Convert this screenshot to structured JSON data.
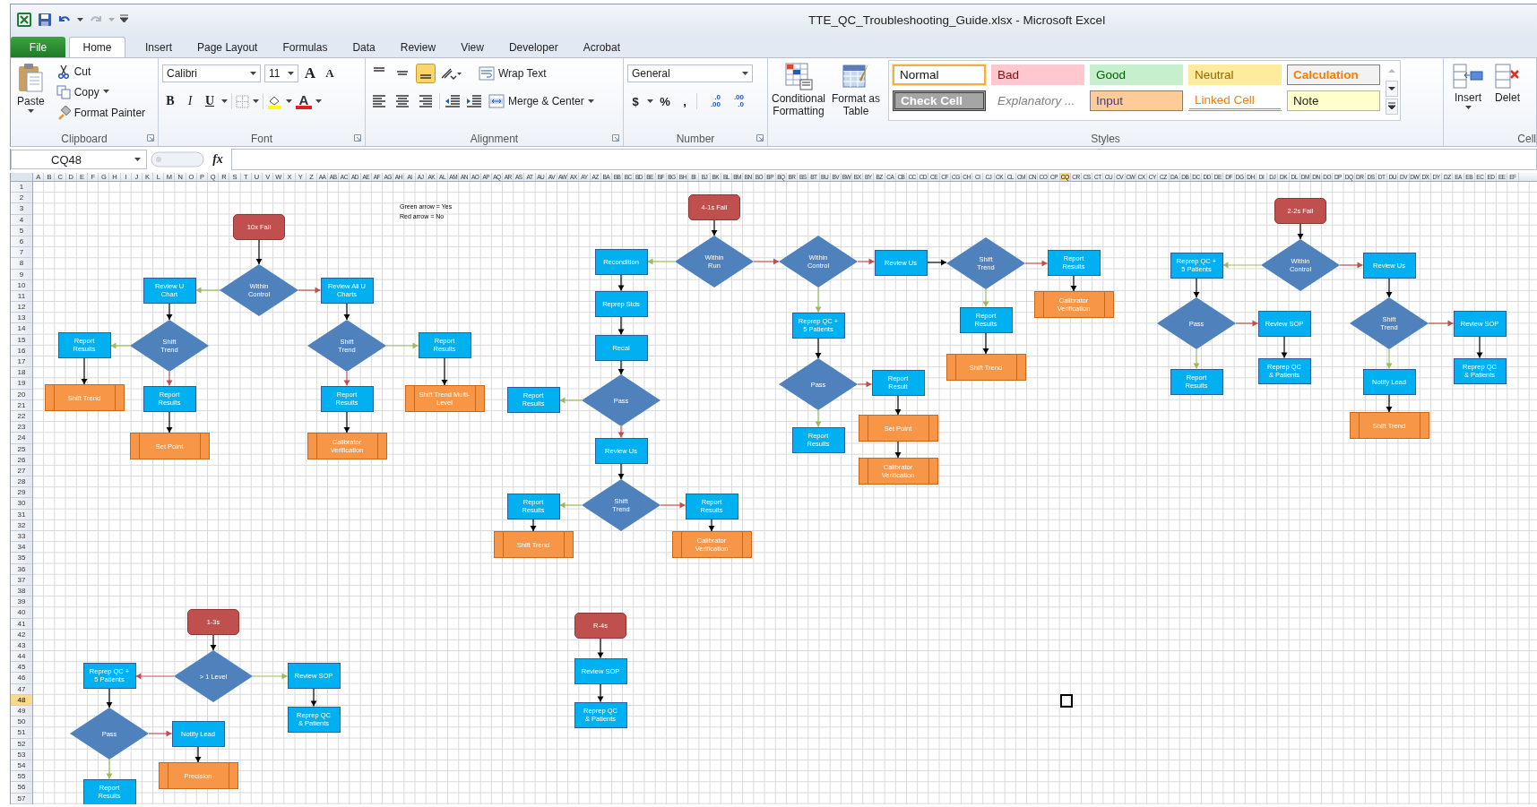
{
  "window": {
    "title": "TTE_QC_Troubleshooting_Guide.xlsx  -  Microsoft Excel"
  },
  "tabs": [
    {
      "label": "File",
      "kind": "file",
      "selected": false
    },
    {
      "label": "Home",
      "kind": "tab",
      "selected": true
    },
    {
      "label": "Insert",
      "kind": "tab",
      "selected": false
    },
    {
      "label": "Page Layout",
      "kind": "tab",
      "selected": false
    },
    {
      "label": "Formulas",
      "kind": "tab",
      "selected": false
    },
    {
      "label": "Data",
      "kind": "tab",
      "selected": false
    },
    {
      "label": "Review",
      "kind": "tab",
      "selected": false
    },
    {
      "label": "View",
      "kind": "tab",
      "selected": false
    },
    {
      "label": "Developer",
      "kind": "tab",
      "selected": false
    },
    {
      "label": "Acrobat",
      "kind": "tab",
      "selected": false
    }
  ],
  "clipboard": {
    "label": "Clipboard",
    "paste": "Paste",
    "cut": "Cut",
    "copy": "Copy",
    "format_painter": "Format Painter"
  },
  "font": {
    "label": "Font",
    "family": "Calibri",
    "size": "11",
    "grow": "A",
    "shrink": "A",
    "bold": "B",
    "italic": "I",
    "underline": "U",
    "font_color": "A"
  },
  "alignment": {
    "label": "Alignment",
    "vertical_align": [
      {
        "selected": false
      },
      {
        "selected": false
      },
      {
        "selected": true
      }
    ],
    "wrap_text": "Wrap Text",
    "merge": "Merge & Center"
  },
  "number": {
    "label": "Number",
    "format": "General",
    "currency": "$",
    "percent": "%",
    "comma": ",",
    "increase_decimal": [
      ".0",
      ".00"
    ],
    "decrease_decimal": [
      ".00",
      ".0"
    ]
  },
  "styles": {
    "label": "Styles",
    "conditional": "Conditional Formatting",
    "format_table": "Format as Table",
    "cells": [
      {
        "label": "Normal",
        "kind": "normal",
        "selected": true
      },
      {
        "label": "Bad",
        "kind": "bad",
        "selected": false
      },
      {
        "label": "Good",
        "kind": "good",
        "selected": false
      },
      {
        "label": "Neutral",
        "kind": "neutral",
        "selected": false
      },
      {
        "label": "Calculation",
        "kind": "calculation",
        "selected": false
      },
      {
        "label": "Check Cell",
        "kind": "check",
        "selected": false
      },
      {
        "label": "Explanatory ...",
        "kind": "explanatory",
        "selected": false
      },
      {
        "label": "Input",
        "kind": "input",
        "selected": false
      },
      {
        "label": "Linked Cell",
        "kind": "linked",
        "selected": false
      },
      {
        "label": "Note",
        "kind": "note",
        "selected": false
      }
    ]
  },
  "cells_group": {
    "label": "Cell",
    "insert": "Insert",
    "delete": "Delet"
  },
  "formula_bar": {
    "name_box": "CQ48",
    "fx": "fx"
  },
  "columns": [
    {
      "label": "A",
      "selected": false
    },
    {
      "label": "B",
      "selected": false
    },
    {
      "label": "C",
      "selected": false
    },
    {
      "label": "D",
      "selected": false
    },
    {
      "label": "E",
      "selected": false
    },
    {
      "label": "F",
      "selected": false
    },
    {
      "label": "G",
      "selected": false
    },
    {
      "label": "H",
      "selected": false
    },
    {
      "label": "I",
      "selected": false
    },
    {
      "label": "J",
      "selected": false
    },
    {
      "label": "K",
      "selected": false
    },
    {
      "label": "L",
      "selected": false
    },
    {
      "label": "M",
      "selected": false
    },
    {
      "label": "N",
      "selected": false
    },
    {
      "label": "O",
      "selected": false
    },
    {
      "label": "P",
      "selected": false
    },
    {
      "label": "Q",
      "selected": false
    },
    {
      "label": "R",
      "selected": false
    },
    {
      "label": "S",
      "selected": false
    },
    {
      "label": "T",
      "selected": false
    },
    {
      "label": "U",
      "selected": false
    },
    {
      "label": "V",
      "selected": false
    },
    {
      "label": "W",
      "selected": false
    },
    {
      "label": "X",
      "selected": false
    },
    {
      "label": "Y",
      "selected": false
    },
    {
      "label": "Z",
      "selected": false
    },
    {
      "label": "AA",
      "selected": false
    },
    {
      "label": "AB",
      "selected": false
    },
    {
      "label": "AC",
      "selected": false
    },
    {
      "label": "AD",
      "selected": false
    },
    {
      "label": "AE",
      "selected": false
    },
    {
      "label": "AF",
      "selected": false
    },
    {
      "label": "AG",
      "selected": false
    },
    {
      "label": "AH",
      "selected": false
    },
    {
      "label": "AI",
      "selected": false
    },
    {
      "label": "AJ",
      "selected": false
    },
    {
      "label": "AK",
      "selected": false
    },
    {
      "label": "AL",
      "selected": false
    },
    {
      "label": "AM",
      "selected": false
    },
    {
      "label": "AN",
      "selected": false
    },
    {
      "label": "AO",
      "selected": false
    },
    {
      "label": "AP",
      "selected": false
    },
    {
      "label": "AQ",
      "selected": false
    },
    {
      "label": "AR",
      "selected": false
    },
    {
      "label": "AS",
      "selected": false
    },
    {
      "label": "AT",
      "selected": false
    },
    {
      "label": "AU",
      "selected": false
    },
    {
      "label": "AV",
      "selected": false
    },
    {
      "label": "AW",
      "selected": false
    },
    {
      "label": "AX",
      "selected": false
    },
    {
      "label": "AY",
      "selected": false
    },
    {
      "label": "AZ",
      "selected": false
    },
    {
      "label": "BA",
      "selected": false
    },
    {
      "label": "BB",
      "selected": false
    },
    {
      "label": "BC",
      "selected": false
    },
    {
      "label": "BD",
      "selected": false
    },
    {
      "label": "BE",
      "selected": false
    },
    {
      "label": "BF",
      "selected": false
    },
    {
      "label": "BG",
      "selected": false
    },
    {
      "label": "BH",
      "selected": false
    },
    {
      "label": "BI",
      "selected": false
    },
    {
      "label": "BJ",
      "selected": false
    },
    {
      "label": "BK",
      "selected": false
    },
    {
      "label": "BL",
      "selected": false
    },
    {
      "label": "BM",
      "selected": false
    },
    {
      "label": "BN",
      "selected": false
    },
    {
      "label": "BO",
      "selected": false
    },
    {
      "label": "BP",
      "selected": false
    },
    {
      "label": "BQ",
      "selected": false
    },
    {
      "label": "BR",
      "selected": false
    },
    {
      "label": "BS",
      "selected": false
    },
    {
      "label": "BT",
      "selected": false
    },
    {
      "label": "BU",
      "selected": false
    },
    {
      "label": "BV",
      "selected": false
    },
    {
      "label": "BW",
      "selected": false
    },
    {
      "label": "BX",
      "selected": false
    },
    {
      "label": "BY",
      "selected": false
    },
    {
      "label": "BZ",
      "selected": false
    },
    {
      "label": "CA",
      "selected": false
    },
    {
      "label": "CB",
      "selected": false
    },
    {
      "label": "CC",
      "selected": false
    },
    {
      "label": "CD",
      "selected": false
    },
    {
      "label": "CE",
      "selected": false
    },
    {
      "label": "CF",
      "selected": false
    },
    {
      "label": "CG",
      "selected": false
    },
    {
      "label": "CH",
      "selected": false
    },
    {
      "label": "CI",
      "selected": false
    },
    {
      "label": "CJ",
      "selected": false
    },
    {
      "label": "CK",
      "selected": false
    },
    {
      "label": "CL",
      "selected": false
    },
    {
      "label": "CM",
      "selected": false
    },
    {
      "label": "CN",
      "selected": false
    },
    {
      "label": "CO",
      "selected": false
    },
    {
      "label": "CP",
      "selected": false
    },
    {
      "label": "CQ",
      "selected": true
    },
    {
      "label": "CR",
      "selected": false
    },
    {
      "label": "CS",
      "selected": false
    },
    {
      "label": "CT",
      "selected": false
    },
    {
      "label": "CU",
      "selected": false
    },
    {
      "label": "CV",
      "selected": false
    },
    {
      "label": "CW",
      "selected": false
    },
    {
      "label": "CX",
      "selected": false
    },
    {
      "label": "CY",
      "selected": false
    },
    {
      "label": "CZ",
      "selected": false
    },
    {
      "label": "DA",
      "selected": false
    },
    {
      "label": "DB",
      "selected": false
    },
    {
      "label": "DC",
      "selected": false
    },
    {
      "label": "DD",
      "selected": false
    },
    {
      "label": "DE",
      "selected": false
    },
    {
      "label": "DF",
      "selected": false
    },
    {
      "label": "DG",
      "selected": false
    },
    {
      "label": "DH",
      "selected": false
    },
    {
      "label": "DI",
      "selected": false
    },
    {
      "label": "DJ",
      "selected": false
    },
    {
      "label": "DK",
      "selected": false
    },
    {
      "label": "DL",
      "selected": false
    },
    {
      "label": "DM",
      "selected": false
    },
    {
      "label": "DN",
      "selected": false
    },
    {
      "label": "DO",
      "selected": false
    },
    {
      "label": "DP",
      "selected": false
    },
    {
      "label": "DQ",
      "selected": false
    },
    {
      "label": "DR",
      "selected": false
    },
    {
      "label": "DS",
      "selected": false
    },
    {
      "label": "DT",
      "selected": false
    },
    {
      "label": "DU",
      "selected": false
    },
    {
      "label": "DV",
      "selected": false
    },
    {
      "label": "DW",
      "selected": false
    },
    {
      "label": "DX",
      "selected": false
    },
    {
      "label": "DY",
      "selected": false
    },
    {
      "label": "DZ",
      "selected": false
    },
    {
      "label": "EA",
      "selected": false
    },
    {
      "label": "EB",
      "selected": false
    },
    {
      "label": "EC",
      "selected": false
    },
    {
      "label": "ED",
      "selected": false
    },
    {
      "label": "EE",
      "selected": false
    },
    {
      "label": "EF",
      "selected": false
    }
  ],
  "rows": [
    {
      "label": "1",
      "selected": false
    },
    {
      "label": "2",
      "selected": false
    },
    {
      "label": "3",
      "selected": false
    },
    {
      "label": "4",
      "selected": false
    },
    {
      "label": "5",
      "selected": false
    },
    {
      "label": "6",
      "selected": false
    },
    {
      "label": "7",
      "selected": false
    },
    {
      "label": "8",
      "selected": false
    },
    {
      "label": "9",
      "selected": false
    },
    {
      "label": "10",
      "selected": false
    },
    {
      "label": "11",
      "selected": false
    },
    {
      "label": "12",
      "selected": false
    },
    {
      "label": "13",
      "selected": false
    },
    {
      "label": "14",
      "selected": false
    },
    {
      "label": "15",
      "selected": false
    },
    {
      "label": "16",
      "selected": false
    },
    {
      "label": "17",
      "selected": false
    },
    {
      "label": "18",
      "selected": false
    },
    {
      "label": "19",
      "selected": false
    },
    {
      "label": "20",
      "selected": false
    },
    {
      "label": "21",
      "selected": false
    },
    {
      "label": "22",
      "selected": false
    },
    {
      "label": "23",
      "selected": false
    },
    {
      "label": "24",
      "selected": false
    },
    {
      "label": "25",
      "selected": false
    },
    {
      "label": "26",
      "selected": false
    },
    {
      "label": "27",
      "selected": false
    },
    {
      "label": "28",
      "selected": false
    },
    {
      "label": "29",
      "selected": false
    },
    {
      "label": "30",
      "selected": false
    },
    {
      "label": "31",
      "selected": false
    },
    {
      "label": "32",
      "selected": false
    },
    {
      "label": "33",
      "selected": false
    },
    {
      "label": "34",
      "selected": false
    },
    {
      "label": "35",
      "selected": false
    },
    {
      "label": "36",
      "selected": false
    },
    {
      "label": "37",
      "selected": false
    },
    {
      "label": "38",
      "selected": false
    },
    {
      "label": "39",
      "selected": false
    },
    {
      "label": "40",
      "selected": false
    },
    {
      "label": "41",
      "selected": false
    },
    {
      "label": "42",
      "selected": false
    },
    {
      "label": "43",
      "selected": false
    },
    {
      "label": "44",
      "selected": false
    },
    {
      "label": "45",
      "selected": false
    },
    {
      "label": "46",
      "selected": false
    },
    {
      "label": "47",
      "selected": false
    },
    {
      "label": "48",
      "selected": true
    },
    {
      "label": "49",
      "selected": false
    },
    {
      "label": "50",
      "selected": false
    },
    {
      "label": "51",
      "selected": false
    },
    {
      "label": "52",
      "selected": false
    },
    {
      "label": "53",
      "selected": false
    },
    {
      "label": "54",
      "selected": false
    },
    {
      "label": "55",
      "selected": false
    },
    {
      "label": "56",
      "selected": false
    },
    {
      "label": "57",
      "selected": false
    }
  ],
  "legend": [
    "Green arrow = Yes",
    "Red arrow = No"
  ],
  "flowcharts": [
    {
      "nodes": [
        {
          "kind": "start",
          "label": "10x Fail"
        },
        {
          "kind": "process",
          "label": "Review U Chart",
          "in_arrow": {
            "kind": "yes"
          }
        },
        {
          "kind": "decision",
          "label": "Within Control",
          "in_arrow": {
            "kind": "next"
          }
        },
        {
          "kind": "process",
          "label": "Review All U Charts",
          "in_arrow": {
            "kind": "no"
          }
        },
        {
          "kind": "process",
          "label": "Report Results",
          "in_arrow": {
            "kind": "yes"
          }
        },
        {
          "kind": "decision",
          "label": "Shift Trend",
          "in_arrow": {
            "kind": "next"
          }
        },
        {
          "kind": "decision",
          "label": "Shift Trend",
          "in_arrow": {
            "kind": "next"
          }
        },
        {
          "kind": "process",
          "label": "Report Results",
          "in_arrow": {
            "kind": "yes"
          }
        },
        {
          "kind": "subprocess",
          "label": "Shift Trend",
          "in_arrow": {
            "kind": "next"
          }
        },
        {
          "kind": "process",
          "label": "Report Results",
          "in_arrow": {
            "kind": "no"
          }
        },
        {
          "kind": "process",
          "label": "Report Results",
          "in_arrow": {
            "kind": "no"
          }
        },
        {
          "kind": "subprocess",
          "label": "Shift Trend Multi-Level",
          "in_arrow": {
            "kind": "next"
          }
        },
        {
          "kind": "subprocess",
          "label": "Set Point",
          "in_arrow": {
            "kind": "next"
          }
        },
        {
          "kind": "subprocess",
          "label": "Calibrator Verification",
          "in_arrow": {
            "kind": "next"
          }
        }
      ]
    },
    {
      "nodes": [
        {
          "kind": "start",
          "label": "4-1s Fail"
        },
        {
          "kind": "process",
          "label": "Recondition",
          "in_arrow": {
            "kind": "yes"
          }
        },
        {
          "kind": "decision",
          "label": "Within Run",
          "in_arrow": {
            "kind": "next"
          }
        },
        {
          "kind": "decision",
          "label": "Within Control",
          "in_arrow": {
            "kind": "no"
          }
        },
        {
          "kind": "process",
          "label": "Review Us",
          "in_arrow": {
            "kind": "no"
          }
        },
        {
          "kind": "decision",
          "label": "Shift Trend",
          "in_arrow": {
            "kind": "next"
          }
        },
        {
          "kind": "process",
          "label": "Report Results",
          "in_arrow": {
            "kind": "no"
          }
        },
        {
          "kind": "process",
          "label": "Reprep Stds",
          "in_arrow": {
            "kind": "next"
          }
        },
        {
          "kind": "process",
          "label": "Reprep QC + 5 Patients",
          "in_arrow": {
            "kind": "yes"
          }
        },
        {
          "kind": "process",
          "label": "Report Results",
          "in_arrow": {
            "kind": "yes"
          }
        },
        {
          "kind": "subprocess",
          "label": "Calibrator Verification",
          "in_arrow": {
            "kind": "next"
          }
        },
        {
          "kind": "process",
          "label": "Recal",
          "in_arrow": {
            "kind": "next"
          }
        },
        {
          "kind": "process",
          "label": "Report Results",
          "in_arrow": {
            "kind": "yes"
          }
        },
        {
          "kind": "decision",
          "label": "Pass",
          "in_arrow": {
            "kind": "next"
          }
        },
        {
          "kind": "decision",
          "label": "Pass",
          "in_arrow": {
            "kind": "next"
          }
        },
        {
          "kind": "process",
          "label": "Report Result",
          "in_arrow": {
            "kind": "no"
          }
        },
        {
          "kind": "subprocess",
          "label": "Shift Trend",
          "in_arrow": {
            "kind": "next"
          }
        },
        {
          "kind": "process",
          "label": "Review Us",
          "in_arrow": {
            "kind": "no"
          }
        },
        {
          "kind": "process",
          "label": "Report Results",
          "in_arrow": {
            "kind": "yes"
          }
        },
        {
          "kind": "subprocess",
          "label": "Set Point",
          "in_arrow": {
            "kind": "next"
          }
        },
        {
          "kind": "subprocess",
          "label": "Calibrator Verification",
          "in_arrow": {
            "kind": "next"
          }
        },
        {
          "kind": "process",
          "label": "Report Results",
          "in_arrow": {
            "kind": "yes"
          }
        },
        {
          "kind": "decision",
          "label": "Shift Trend",
          "in_arrow": {
            "kind": "next"
          }
        },
        {
          "kind": "process",
          "label": "Report Results",
          "in_arrow": {
            "kind": "no"
          }
        },
        {
          "kind": "subprocess",
          "label": "Shift Trend",
          "in_arrow": {
            "kind": "next"
          }
        },
        {
          "kind": "subprocess",
          "label": "Calibrator Verification",
          "in_arrow": {
            "kind": "next"
          }
        }
      ]
    },
    {
      "nodes": [
        {
          "kind": "start",
          "label": "2-2s Fail"
        },
        {
          "kind": "process",
          "label": "Reprep QC + 5 Patients",
          "in_arrow": {
            "kind": "yes"
          }
        },
        {
          "kind": "decision",
          "label": "Within Control",
          "in_arrow": {
            "kind": "next"
          }
        },
        {
          "kind": "process",
          "label": "Review Us",
          "in_arrow": {
            "kind": "no"
          }
        },
        {
          "kind": "decision",
          "label": "Pass",
          "in_arrow": {
            "kind": "next"
          }
        },
        {
          "kind": "process",
          "label": "Review SOP",
          "in_arrow": {
            "kind": "no"
          }
        },
        {
          "kind": "decision",
          "label": "Shift Trend",
          "in_arrow": {
            "kind": "next"
          }
        },
        {
          "kind": "process",
          "label": "Review SOP",
          "in_arrow": {
            "kind": "no"
          }
        },
        {
          "kind": "process",
          "label": "Report Results",
          "in_arrow": {
            "kind": "yes"
          }
        },
        {
          "kind": "process",
          "label": "Reprep QC & Patients",
          "in_arrow": {
            "kind": "next"
          }
        },
        {
          "kind": "process",
          "label": "Notify Lead",
          "in_arrow": {
            "kind": "yes"
          }
        },
        {
          "kind": "process",
          "label": "Reprep QC & Patients",
          "in_arrow": {
            "kind": "next"
          }
        },
        {
          "kind": "subprocess",
          "label": "Shift Trend",
          "in_arrow": {
            "kind": "next"
          }
        }
      ]
    },
    {
      "nodes": [
        {
          "kind": "start",
          "label": "1-3s"
        },
        {
          "kind": "process",
          "label": "Reprep QC + 5 Patients",
          "in_arrow": {
            "kind": "no"
          }
        },
        {
          "kind": "decision",
          "label": "> 1 Level",
          "in_arrow": {
            "kind": "next"
          }
        },
        {
          "kind": "process",
          "label": "Review SOP",
          "in_arrow": {
            "kind": "yes"
          }
        },
        {
          "kind": "decision",
          "label": "Pass",
          "in_arrow": {
            "kind": "next"
          }
        },
        {
          "kind": "process",
          "label": "Notify Lead",
          "in_arrow": {
            "kind": "no"
          }
        },
        {
          "kind": "process",
          "label": "Reprep QC & Patients",
          "in_arrow": {
            "kind": "next"
          }
        },
        {
          "kind": "process",
          "label": "Report Results",
          "in_arrow": {
            "kind": "yes"
          }
        },
        {
          "kind": "subprocess",
          "label": "Precision",
          "in_arrow": {
            "kind": "next"
          }
        }
      ]
    },
    {
      "nodes": [
        {
          "kind": "start",
          "label": "R-4s"
        },
        {
          "kind": "process",
          "label": "Review SOP",
          "in_arrow": {
            "kind": "next"
          }
        },
        {
          "kind": "process",
          "label": "Reprep QC & Patients",
          "in_arrow": {
            "kind": "next"
          }
        }
      ]
    }
  ]
}
